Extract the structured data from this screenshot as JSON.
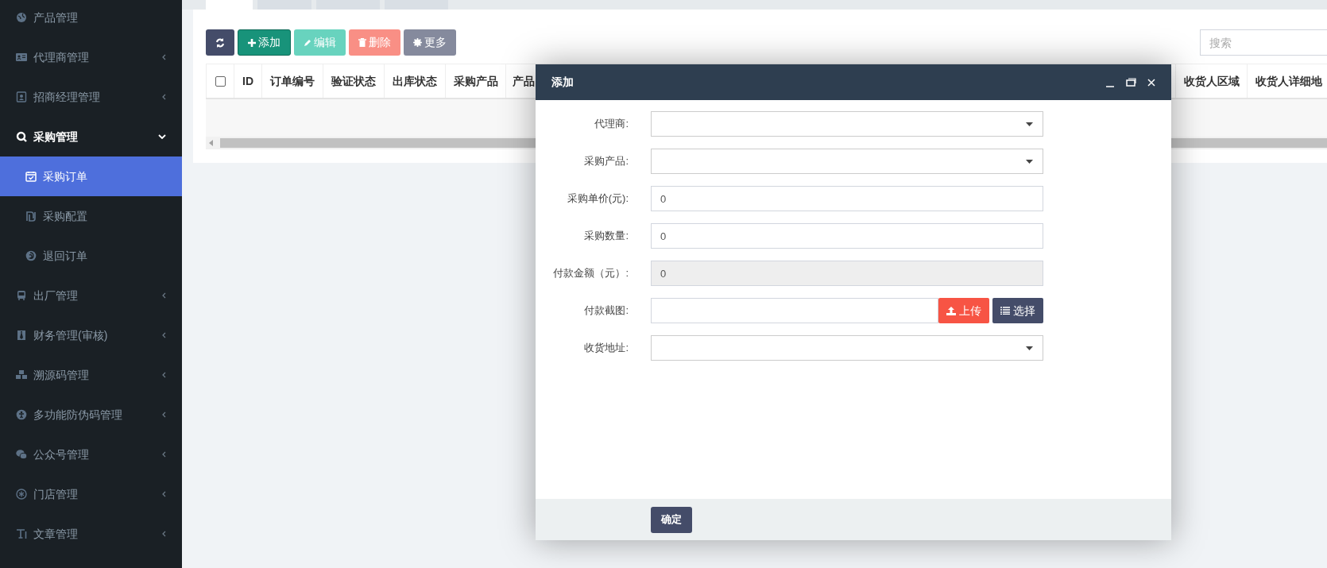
{
  "sidebar": {
    "items": [
      {
        "label": "产品管理",
        "kind": "link"
      },
      {
        "label": "代理商管理",
        "kind": "group",
        "expanded": false
      },
      {
        "label": "招商经理管理",
        "kind": "group",
        "expanded": false
      },
      {
        "label": "采购管理",
        "kind": "group",
        "expanded": true,
        "children": [
          {
            "label": "采购订单",
            "selected": true
          },
          {
            "label": "采购配置",
            "selected": false
          },
          {
            "label": "退回订单",
            "selected": false
          }
        ]
      },
      {
        "label": "出厂管理",
        "kind": "group",
        "expanded": false
      },
      {
        "label": "财务管理(审核)",
        "kind": "group",
        "expanded": false
      },
      {
        "label": "溯源码管理",
        "kind": "group",
        "expanded": false
      },
      {
        "label": "多功能防伪码管理",
        "kind": "group",
        "expanded": false
      },
      {
        "label": "公众号管理",
        "kind": "group",
        "expanded": false
      },
      {
        "label": "门店管理",
        "kind": "group",
        "expanded": false
      },
      {
        "label": "文章管理",
        "kind": "group",
        "expanded": false
      }
    ]
  },
  "tabs": [
    {
      "selected": true
    },
    {
      "selected": false
    },
    {
      "selected": false
    },
    {
      "selected": false
    }
  ],
  "toolbar": {
    "buttons": [
      {
        "kind": "refresh",
        "disabled": false
      },
      {
        "kind": "add",
        "label": "添加",
        "disabled": false
      },
      {
        "kind": "edit",
        "label": "编辑",
        "disabled": true
      },
      {
        "kind": "delete",
        "label": "删除",
        "disabled": true
      },
      {
        "kind": "more",
        "label": "更多",
        "disabled": true
      }
    ],
    "search": {
      "placeholder": "搜索"
    }
  },
  "table": {
    "select_all": {
      "checked": false
    },
    "columns": [
      "ID",
      "订单编号",
      "验证状态",
      "出库状态",
      "采购产品",
      "产品",
      "收货人区域",
      "收货人详细地"
    ]
  },
  "dialog": {
    "title": "添加",
    "fields": [
      {
        "label": "代理商:",
        "kind": "select"
      },
      {
        "label": "采购产品:",
        "kind": "select"
      },
      {
        "label": "采购单价(元):",
        "kind": "text",
        "value": "0"
      },
      {
        "label": "采购数量:",
        "kind": "text",
        "value": "0"
      },
      {
        "label": "付款金额（元）:",
        "kind": "readonly",
        "value": "0"
      },
      {
        "label": "付款截图:",
        "kind": "upload",
        "buttons": [
          "上传",
          "选择"
        ]
      },
      {
        "label": "收货地址:",
        "kind": "select"
      }
    ],
    "confirm": "确定"
  }
}
